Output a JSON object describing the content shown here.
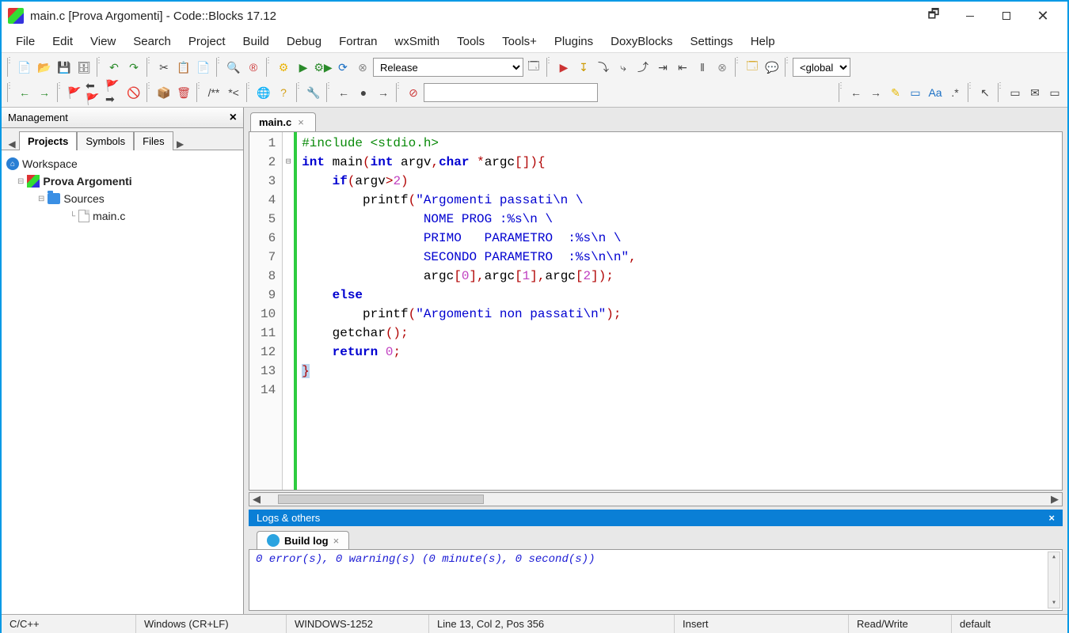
{
  "window": {
    "title": "main.c [Prova Argomenti] - Code::Blocks 17.12"
  },
  "menu": [
    "File",
    "Edit",
    "View",
    "Search",
    "Project",
    "Build",
    "Debug",
    "Fortran",
    "wxSmith",
    "Tools",
    "Tools+",
    "Plugins",
    "DoxyBlocks",
    "Settings",
    "Help"
  ],
  "toolbar": {
    "build_target": "Release",
    "scope": "<global"
  },
  "management": {
    "title": "Management",
    "tabs": [
      "Projects",
      "Symbols",
      "Files"
    ],
    "active_tab": "Projects",
    "tree": {
      "workspace": "Workspace",
      "project": "Prova Argomenti",
      "folder": "Sources",
      "file": "main.c"
    }
  },
  "editor": {
    "tab": "main.c",
    "lines": [
      {
        "n": 1,
        "html": "<span class='pp'>#include &lt;stdio.h&gt;</span>"
      },
      {
        "n": 2,
        "html": "<span class='kw'>int</span> main<span class='op'>(</span><span class='kw'>int</span> argv<span class='op'>,</span><span class='kw'>char</span> <span class='op'>*</span>argc<span class='op'>[]){</span>"
      },
      {
        "n": 3,
        "html": "    <span class='kw'>if</span><span class='op'>(</span>argv<span class='op'>&gt;</span><span class='num'>2</span><span class='op'>)</span>"
      },
      {
        "n": 4,
        "html": "        printf<span class='op'>(</span><span class='str'>\"Argomenti passati\\n \\</span>"
      },
      {
        "n": 5,
        "html": "<span class='str'>                NOME PROG :%s\\n \\</span>"
      },
      {
        "n": 6,
        "html": "<span class='str'>                PRIMO   PARAMETRO  :%s\\n \\</span>"
      },
      {
        "n": 7,
        "html": "<span class='str'>                SECONDO PARAMETRO  :%s\\n\\n\"</span><span class='op'>,</span>"
      },
      {
        "n": 8,
        "html": "                argc<span class='op'>[</span><span class='num'>0</span><span class='op'>],</span>argc<span class='op'>[</span><span class='num'>1</span><span class='op'>],</span>argc<span class='op'>[</span><span class='num'>2</span><span class='op'>]);</span>"
      },
      {
        "n": 9,
        "html": "    <span class='kw'>else</span>"
      },
      {
        "n": 10,
        "html": "        printf<span class='op'>(</span><span class='str'>\"Argomenti non passati\\n\"</span><span class='op'>);</span>"
      },
      {
        "n": 11,
        "html": "    getchar<span class='op'>();</span>"
      },
      {
        "n": 12,
        "html": "    <span class='kw'>return</span> <span class='num'>0</span><span class='op'>;</span>"
      },
      {
        "n": 13,
        "html": "<span class='op cursel'>}</span>"
      },
      {
        "n": 14,
        "html": ""
      }
    ]
  },
  "logs": {
    "panel_title": "Logs & others",
    "tab": "Build log",
    "text": "0 error(s), 0 warning(s) (0 minute(s), 0 second(s))"
  },
  "status": {
    "lang": "C/C++",
    "eol": "Windows (CR+LF)",
    "enc": "WINDOWS-1252",
    "pos": "Line 13, Col 2, Pos 356",
    "ins": "Insert",
    "rw": "Read/Write",
    "profile": "default"
  }
}
